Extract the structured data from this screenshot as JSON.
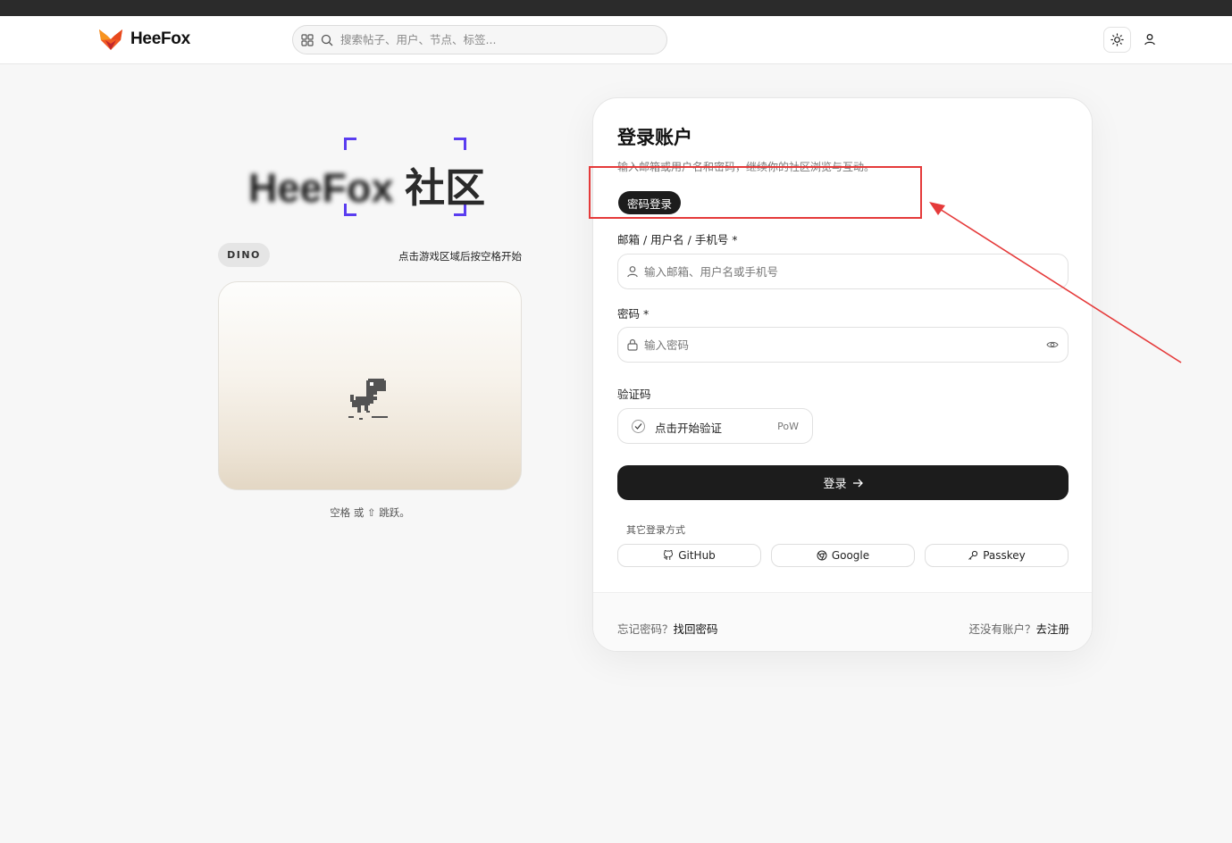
{
  "header": {
    "brand": "HeeFox",
    "search_placeholder": "搜索帖子、用户、节点、标签..."
  },
  "hero": {
    "title_blurred": "HeeFox",
    "title_clear": "社区"
  },
  "game": {
    "badge": "DINO",
    "hint": "点击游戏区域后按空格开始",
    "caption": "空格 或 ⇧ 跳跃。"
  },
  "login": {
    "title": "登录账户",
    "subtitle": "输入邮箱或用户名和密码，继续你的社区浏览与互动。",
    "tab": "密码登录",
    "account_label": "邮箱 / 用户名 / 手机号 *",
    "account_placeholder": "输入邮箱、用户名或手机号",
    "password_label": "密码 *",
    "password_placeholder": "输入密码",
    "captcha_label": "验证码",
    "captcha_text": "点击开始验证",
    "captcha_tag": "PoW",
    "submit": "登录",
    "other_methods": "其它登录方式",
    "oauth": [
      "GitHub",
      "Google",
      "Passkey"
    ],
    "forgot_prefix": "忘记密码？",
    "forgot_link": "找回密码",
    "register_prefix": "还没有账户？",
    "register_link": "去注册"
  },
  "colors": {
    "accent_dark": "#1c1c1c",
    "fox_orange": "#f15a24",
    "scan_corner": "#5a3df0",
    "annotation_red": "#e53a3a"
  }
}
